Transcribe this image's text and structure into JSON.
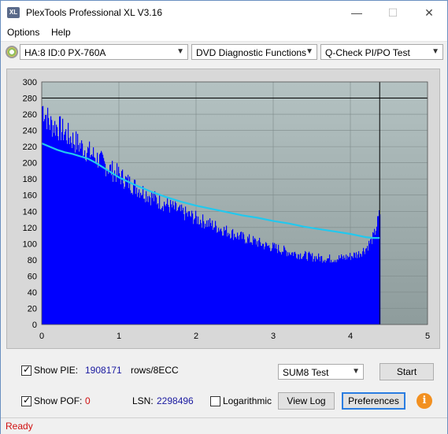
{
  "window": {
    "icon_text": "XL",
    "title": "PlexTools Professional XL V3.16",
    "minimize": "—",
    "maximize": "☐",
    "close": "✕"
  },
  "menu": {
    "options": "Options",
    "help": "Help"
  },
  "toolbar": {
    "drive": "HA:8 ID:0  PX-760A",
    "function": "DVD Diagnostic Functions",
    "test": "Q-Check PI/PO Test"
  },
  "chart_data": {
    "type": "bar",
    "title": "",
    "xlabel": "",
    "ylabel": "",
    "xlim": [
      0,
      5
    ],
    "ylim": [
      0,
      300
    ],
    "xticks": [
      "0",
      "1",
      "2",
      "3",
      "4",
      "5"
    ],
    "yticks": [
      "0",
      "20",
      "40",
      "60",
      "80",
      "100",
      "120",
      "140",
      "160",
      "180",
      "200",
      "220",
      "240",
      "260",
      "280",
      "300"
    ],
    "reference_line_y": 280,
    "end_marker_x": 4.38,
    "colors": {
      "bars": "#0000ff",
      "speed_line": "#22c8ee",
      "background": "#a6b4b4",
      "grid": "#7e8a8a"
    },
    "series": [
      {
        "kind": "bars",
        "x": [
          0.0,
          0.1,
          0.2,
          0.3,
          0.4,
          0.5,
          0.6,
          0.7,
          0.8,
          0.9,
          1.0,
          1.1,
          1.2,
          1.3,
          1.4,
          1.5,
          1.6,
          1.7,
          1.8,
          1.9,
          2.0,
          2.1,
          2.2,
          2.3,
          2.4,
          2.5,
          2.6,
          2.7,
          2.8,
          2.9,
          3.0,
          3.1,
          3.2,
          3.3,
          3.4,
          3.5,
          3.6,
          3.7,
          3.8,
          3.9,
          4.0,
          4.1,
          4.2,
          4.3,
          4.38
        ],
        "values": [
          272,
          250,
          246,
          238,
          230,
          222,
          215,
          208,
          200,
          192,
          186,
          178,
          172,
          166,
          160,
          154,
          150,
          145,
          140,
          136,
          132,
          128,
          124,
          120,
          116,
          112,
          108,
          105,
          102,
          98,
          96,
          93,
          90,
          88,
          86,
          84,
          83,
          82,
          82,
          83,
          85,
          88,
          95,
          110,
          140
        ]
      },
      {
        "kind": "line",
        "x": [
          0.0,
          0.1,
          0.2,
          0.3,
          0.4,
          0.5,
          0.6,
          0.7,
          0.8,
          0.9,
          1.0,
          1.2,
          1.4,
          1.6,
          1.8,
          2.0,
          2.2,
          2.4,
          2.6,
          2.8,
          3.0,
          3.2,
          3.4,
          3.6,
          3.8,
          4.0,
          4.1,
          4.2,
          4.3,
          4.38
        ],
        "values": [
          224,
          220,
          216,
          213,
          211,
          208,
          205,
          200,
          194,
          188,
          182,
          173,
          165,
          158,
          152,
          147,
          143,
          139,
          135,
          132,
          128,
          125,
          121,
          118,
          115,
          112,
          110,
          108,
          107,
          107
        ]
      }
    ]
  },
  "controls": {
    "show_pie_label": "Show PIE:",
    "pie_value": "1908171",
    "pie_unit": "rows/8ECC",
    "show_pof_label": "Show POF:",
    "pof_value": "0",
    "lsn_label": "LSN:",
    "lsn_value": "2298496",
    "logarithmic_label": "Logarithmic",
    "sum_select": "SUM8 Test",
    "start_button": "Start",
    "view_log_button": "View Log",
    "preferences_button": "Preferences",
    "info_button": "i"
  },
  "status": {
    "text": "Ready"
  }
}
